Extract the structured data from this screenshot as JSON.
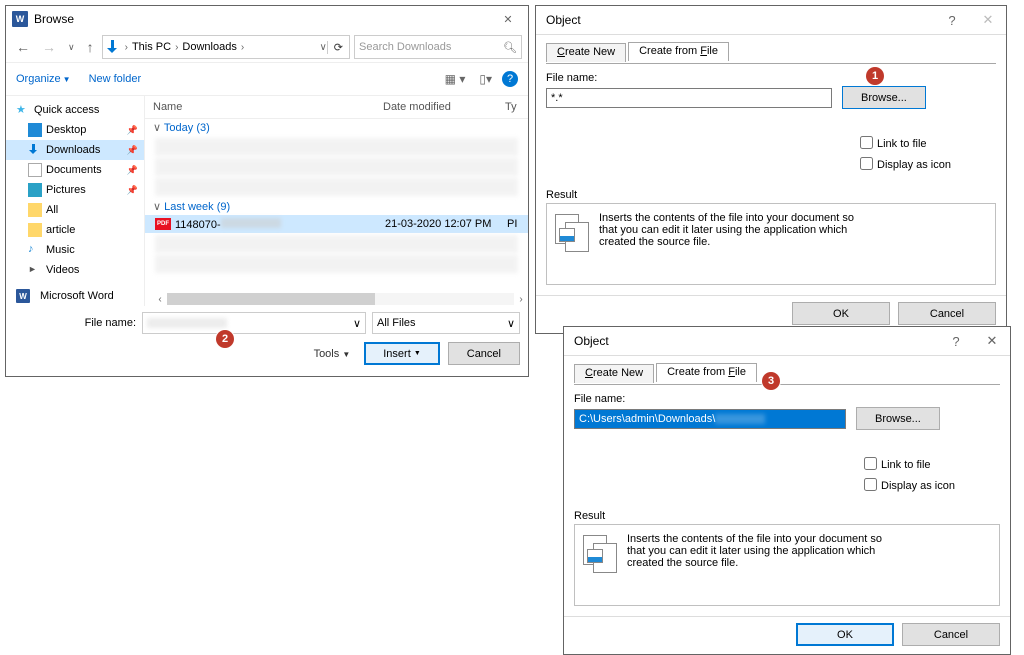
{
  "browse": {
    "title": "Browse",
    "breadcrumb": {
      "seg1": "This PC",
      "seg2": "Downloads"
    },
    "search_placeholder": "Search Downloads",
    "organize": "Organize",
    "newfolder": "New folder",
    "cols": {
      "name": "Name",
      "date": "Date modified",
      "type": "Ty"
    },
    "sidebar": {
      "quick": "Quick access",
      "desktop": "Desktop",
      "downloads": "Downloads",
      "documents": "Documents",
      "pictures": "Pictures",
      "all": "All",
      "article": "article",
      "music": "Music",
      "videos": "Videos",
      "msword": "Microsoft Word"
    },
    "groups": {
      "today": "Today (3)",
      "lastweek": "Last week (9)"
    },
    "selected_file": {
      "name": "1148070-",
      "date": "21-03-2020 12:07 PM",
      "type": "PI"
    },
    "filename_lbl": "File name:",
    "filter": "All Files",
    "tools": "Tools",
    "insert": "Insert",
    "cancel": "Cancel"
  },
  "obj": {
    "title": "Object",
    "tab_create": "Create New",
    "tab_file_prefix": "Create from ",
    "tab_file_u": "F",
    "tab_file_suffix": "ile",
    "filename_lbl": "File name:",
    "value1": "*.*",
    "value2": "C:\\Users\\admin\\Downloads\\",
    "browse_u": "B",
    "browse_rest": "rowse...",
    "link": "Link to file",
    "icon": "Display as icon",
    "result_lbl": "Result",
    "result_text": "Inserts the contents of the file into your document so that you can edit it later using the application which created the source file.",
    "ok": "OK",
    "cancel": "Cancel"
  },
  "badges": {
    "b1": "1",
    "b2": "2",
    "b3": "3"
  }
}
